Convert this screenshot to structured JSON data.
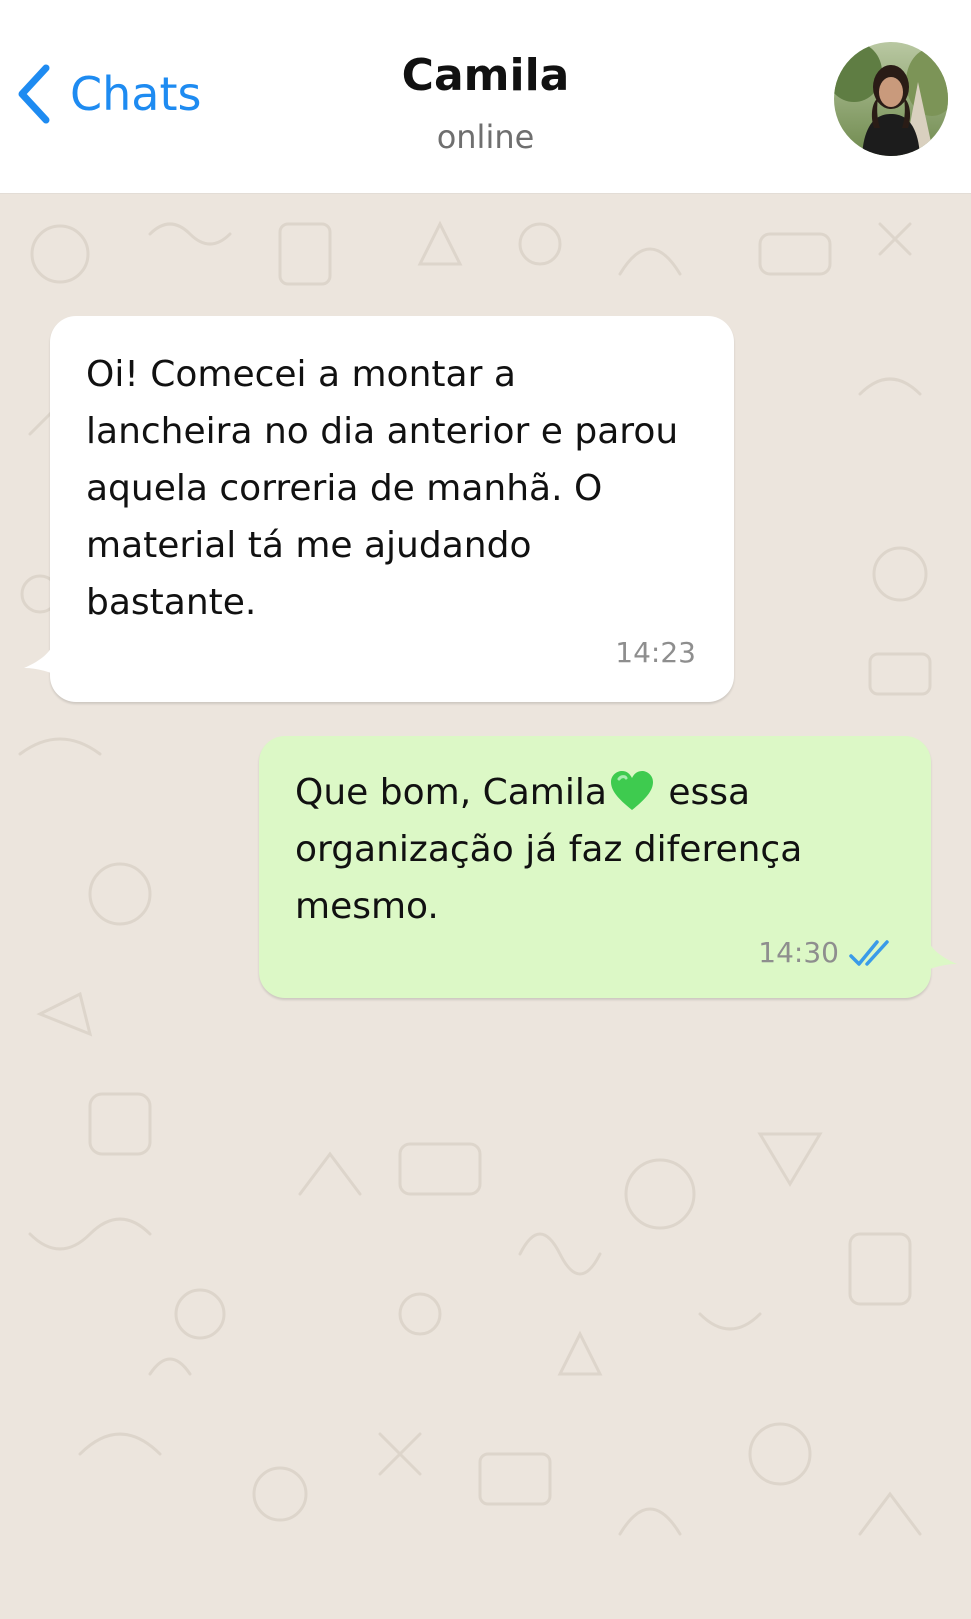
{
  "header": {
    "back_label": "Chats",
    "contact_name": "Camila",
    "status": "online"
  },
  "messages": [
    {
      "direction": "incoming",
      "text": "Oi! Comecei a montar a\nlancheira no dia anterior e parou\naquela correria de manhã. O\nmaterial tá me ajudando\nbastante.",
      "time": "14:23"
    },
    {
      "direction": "outgoing",
      "text_before": "Que bom, Camila",
      "emoji": "green-heart",
      "text_after": "essa\norganização já faz diferença\nmesmo.",
      "time": "14:30",
      "read_status": "read-double-check"
    }
  ],
  "colors": {
    "accent": "#1e8bf1",
    "incoming_bubble": "#ffffff",
    "outgoing_bubble": "#dcf8c6",
    "wallpaper": "#ece5dd",
    "read_ticks": "#3a9be8",
    "heart": "#3ecb4f"
  }
}
